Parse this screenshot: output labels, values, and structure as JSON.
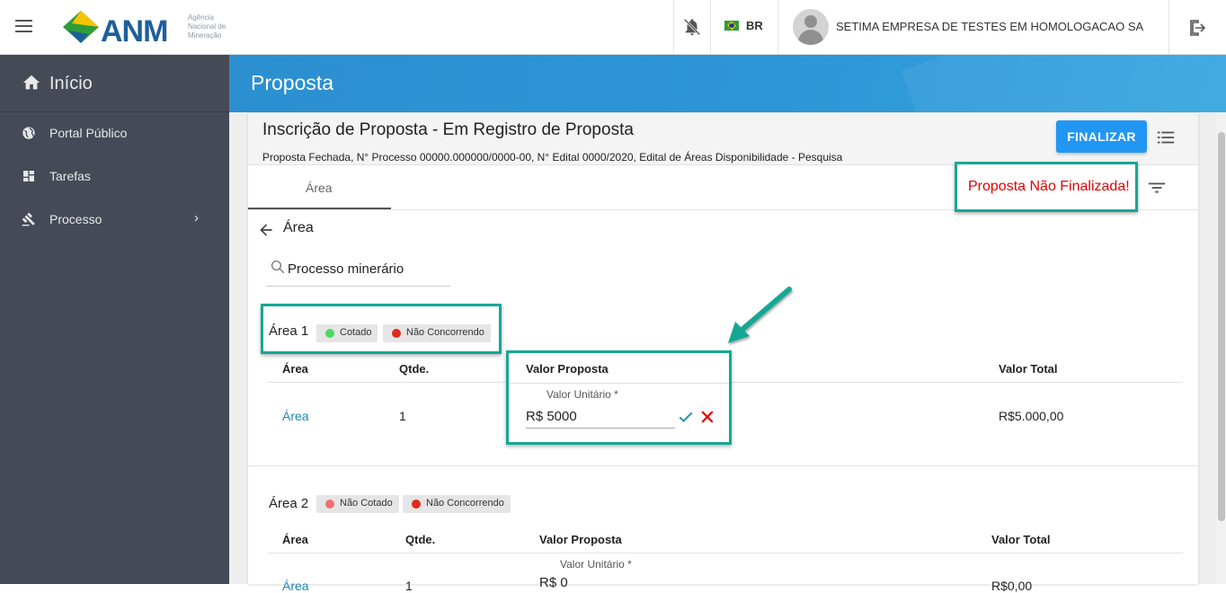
{
  "app": {
    "logo_text": "ANM",
    "logo_subtitle": "Agência Nacional de Mineração",
    "language": "BR",
    "company": "SETIMA EMPRESA DE TESTES EM HOMOLOGACAO SA"
  },
  "sidebar": {
    "home": "Início",
    "items": [
      {
        "label": "Portal Público",
        "icon": "globe-icon"
      },
      {
        "label": "Tarefas",
        "icon": "dashboard-icon"
      },
      {
        "label": "Processo",
        "icon": "gavel-icon"
      }
    ]
  },
  "page": {
    "header_title": "Proposta",
    "card_title": "Inscrição de Proposta - Em Registro de Proposta",
    "card_subtitle": "Proposta Fechada, N° Processo 00000.000000/0000-00, N° Edital 0000/2020, Edital de Áreas Disponibilidade - Pesquisa",
    "finalize_button": "FINALIZAR",
    "tab_area": "Área",
    "status_text": "Proposta Não Finalizada!",
    "back_label": "Área",
    "search_value": "Processo minerário"
  },
  "columns": {
    "area": "Área",
    "qtde": "Qtde.",
    "valor_proposta": "Valor Proposta",
    "valor_total": "Valor Total"
  },
  "areas": [
    {
      "title": "Área 1",
      "chips": [
        {
          "label": "Cotado",
          "color": "#4cd964"
        },
        {
          "label": "Não Concorrendo",
          "color": "#e02a1a"
        }
      ],
      "row": {
        "area": "Área",
        "qtde": "1",
        "valor_label": "Valor Unitário *",
        "valor_value": "R$ 5000",
        "valor_total": "R$5.000,00"
      }
    },
    {
      "title": "Área 2",
      "chips": [
        {
          "label": "Não Cotado",
          "color": "#f07070"
        },
        {
          "label": "Não Concorrendo",
          "color": "#e02a1a"
        }
      ],
      "row": {
        "area": "Área",
        "qtde": "1",
        "valor_label": "Valor Unitário *",
        "valor_value": "R$ 0",
        "valor_total": "R$0,00"
      }
    }
  ],
  "colors": {
    "sidebar_bg": "#454a56",
    "header_blue": "#2d96d6",
    "primary_button": "#2196f3",
    "highlight_teal": "#16a794",
    "status_red": "#e60000"
  }
}
